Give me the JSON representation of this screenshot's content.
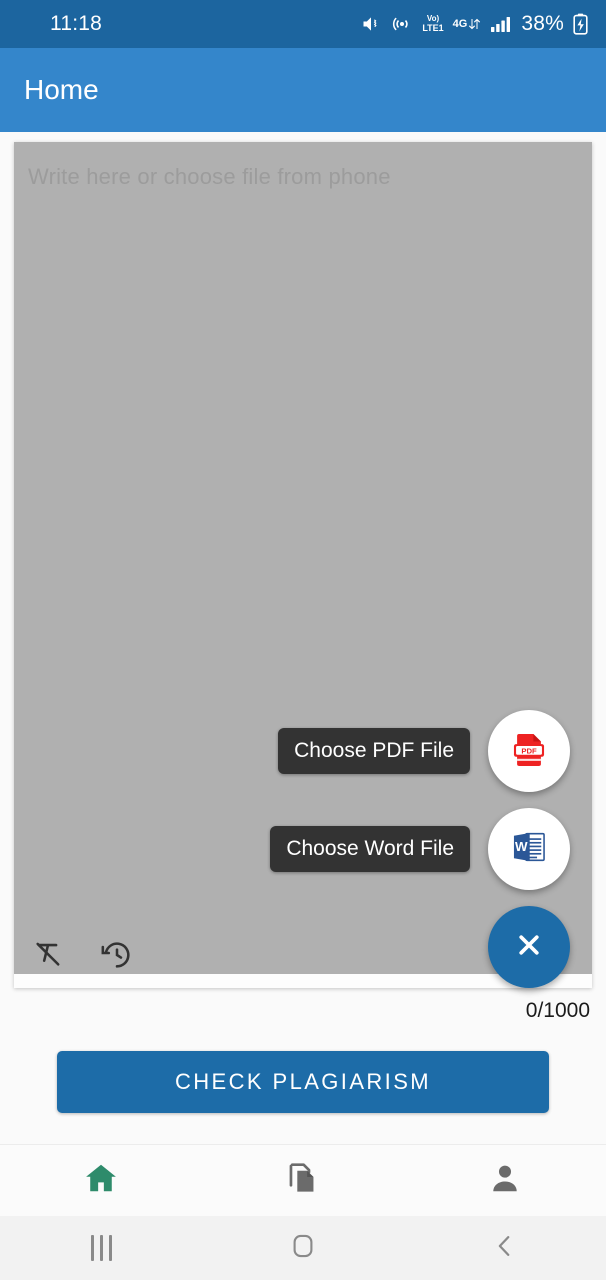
{
  "status_bar": {
    "time": "11:18",
    "battery_percent": "38%",
    "volte_top": "Vo)",
    "volte_bottom": "LTE1",
    "network_type": "4G",
    "icons": [
      "mute-icon",
      "hotspot-icon",
      "volte-icon",
      "mobile-data-icon",
      "signal-bars-icon",
      "battery-charging-icon"
    ],
    "bg_color": "#1c659f"
  },
  "app_bar": {
    "title": "Home",
    "bg_color": "#3486cb"
  },
  "editor": {
    "placeholder": "Write here or choose file from phone",
    "value": "",
    "bg_color": "#b0b0b0",
    "tools": [
      {
        "name": "clear-formatting-icon",
        "label": "Clear formatting"
      },
      {
        "name": "history-icon",
        "label": "History"
      }
    ]
  },
  "counter": {
    "text": "0/1000",
    "used": 0,
    "limit": 1000
  },
  "primary_action": {
    "label": "CHECK PLAGIARISM",
    "bg_color": "#1d6ca8"
  },
  "fab_menu": {
    "expanded": true,
    "items": [
      {
        "label": "Choose PDF File",
        "icon": "pdf-file-icon",
        "icon_color": "#ee2222"
      },
      {
        "label": "Choose Word File",
        "icon": "word-file-icon",
        "icon_color": "#2b5797"
      }
    ],
    "main": {
      "icon": "close-icon",
      "bg_color": "#1d6ca8"
    }
  },
  "bottom_nav": {
    "items": [
      {
        "name": "nav-home",
        "icon": "home-icon",
        "active": true,
        "color": "#2e8b6b"
      },
      {
        "name": "nav-documents",
        "icon": "documents-icon",
        "active": false,
        "color": "#6b6b6b"
      },
      {
        "name": "nav-profile",
        "icon": "person-icon",
        "active": false,
        "color": "#6b6b6b"
      }
    ]
  },
  "android_nav": {
    "items": [
      {
        "name": "recents-button",
        "icon": "recents-icon"
      },
      {
        "name": "home-button",
        "icon": "home-square-icon"
      },
      {
        "name": "back-button",
        "icon": "back-chevron-icon"
      }
    ]
  }
}
